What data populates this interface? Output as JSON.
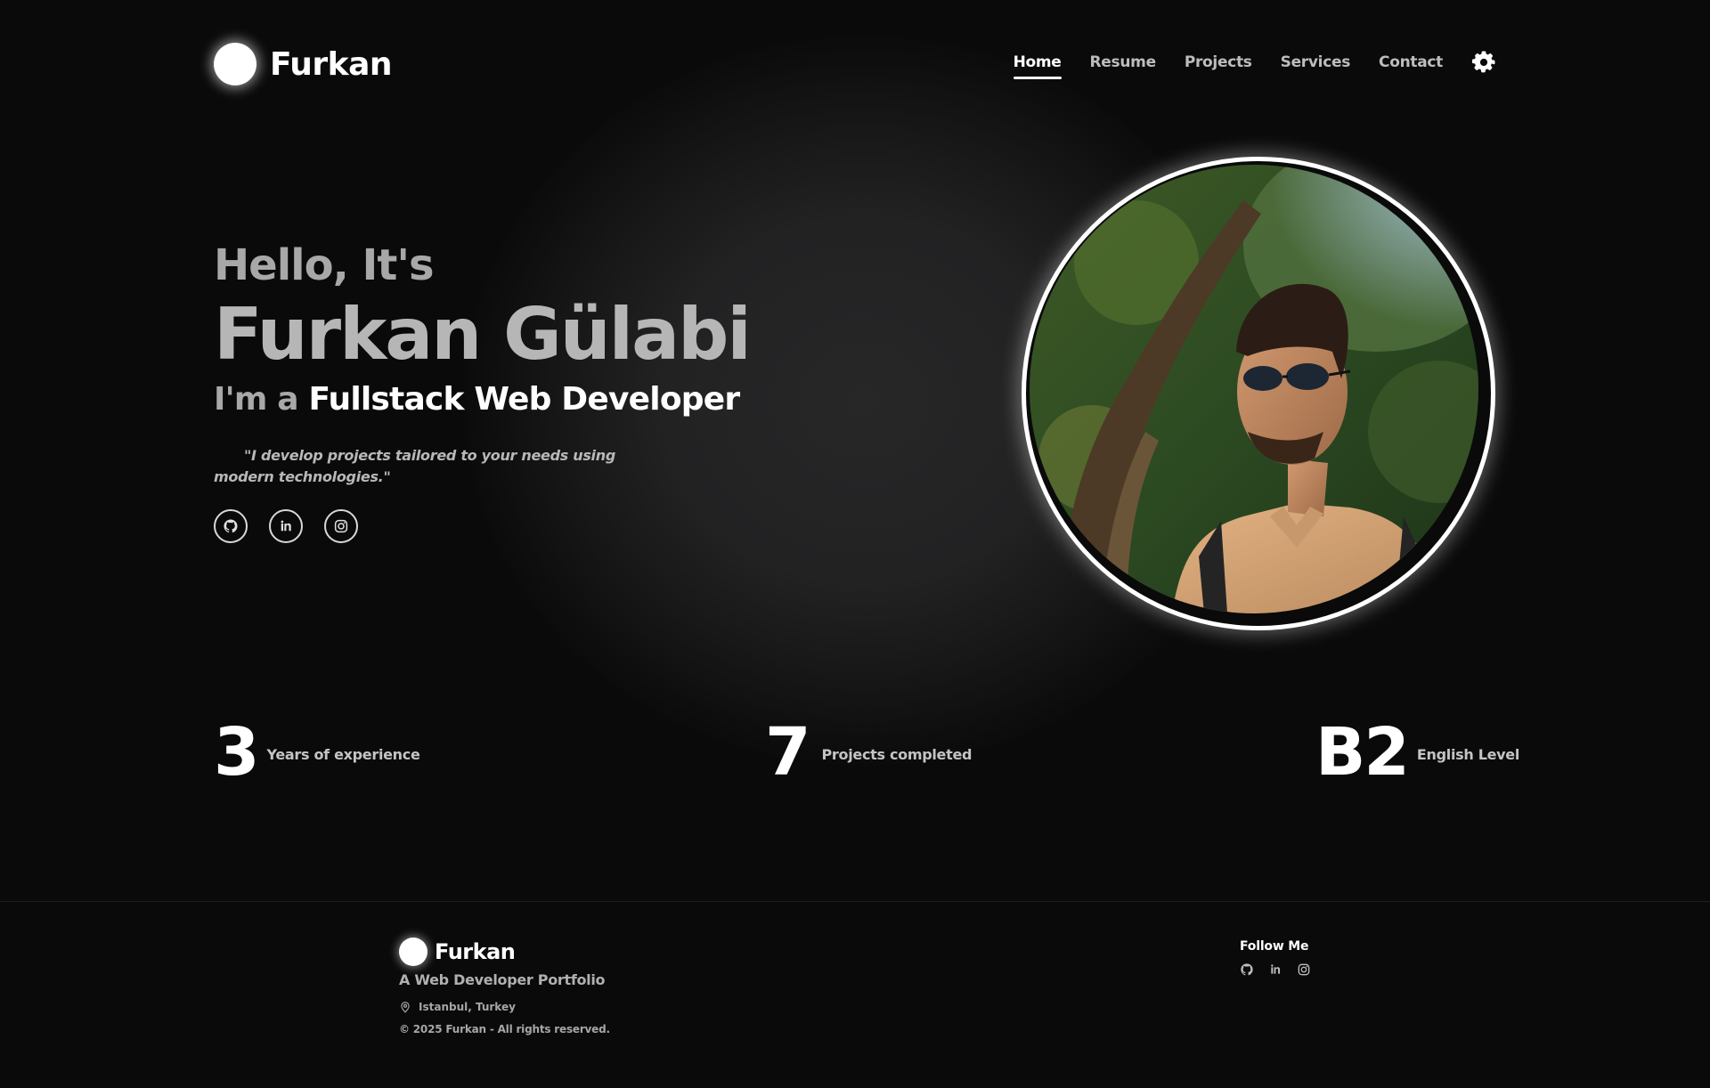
{
  "brand": {
    "name": "Furkan"
  },
  "nav": {
    "items": [
      {
        "label": "Home",
        "active": true
      },
      {
        "label": "Resume"
      },
      {
        "label": "Projects"
      },
      {
        "label": "Services"
      },
      {
        "label": "Contact"
      }
    ],
    "settings_icon": "gear-icon"
  },
  "hero": {
    "greeting": "Hello, It's",
    "name": "Furkan Gülabi",
    "role_prefix": "I'm a",
    "role": "Fullstack Web Developer",
    "quote": "\"I develop projects tailored to your needs using modern technologies.\"",
    "socials": [
      "github-icon",
      "linkedin-icon",
      "instagram-icon"
    ]
  },
  "stats": [
    {
      "value": "3",
      "label": "Years of experience"
    },
    {
      "value": "7",
      "label": "Projects completed"
    },
    {
      "value": "B2",
      "label": "English Level"
    }
  ],
  "footer": {
    "name": "Furkan",
    "tagline": "A Web Developer Portfolio",
    "location": "Istanbul, Turkey",
    "copyright": "© 2025 Furkan - All rights reserved.",
    "follow_label": "Follow Me",
    "socials": [
      "github-icon",
      "linkedin-icon",
      "instagram-icon"
    ]
  },
  "colors": {
    "background": "#0a0a0b",
    "accent": "#ffffff",
    "muted_text": "#b6b6b6"
  }
}
